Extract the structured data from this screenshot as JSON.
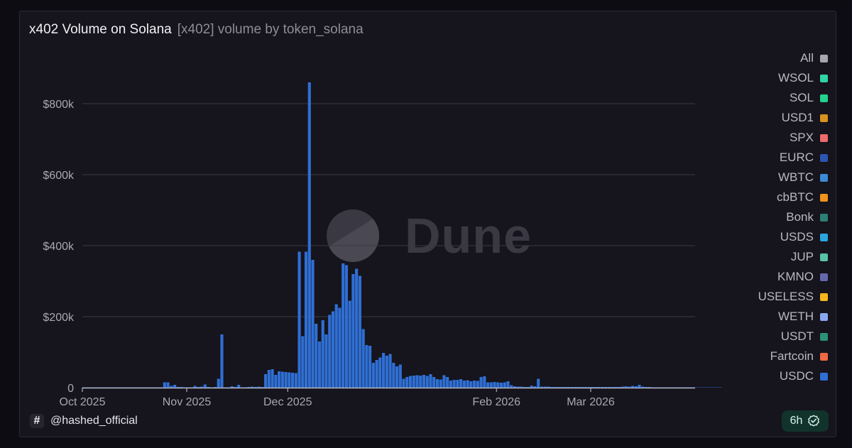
{
  "header": {
    "title": "x402 Volume on Solana",
    "subtitle": "[x402] volume by token_solana"
  },
  "legend": {
    "items": [
      {
        "label": "All",
        "color": "#a7a5ae"
      },
      {
        "label": "WSOL",
        "color": "#2fd6a2"
      },
      {
        "label": "SOL",
        "color": "#22d28f"
      },
      {
        "label": "USD1",
        "color": "#d9921f"
      },
      {
        "label": "SPX",
        "color": "#ef6a6a"
      },
      {
        "label": "EURC",
        "color": "#2d55b0"
      },
      {
        "label": "WBTC",
        "color": "#3d8ad6"
      },
      {
        "label": "cbBTC",
        "color": "#f2931d"
      },
      {
        "label": "Bonk",
        "color": "#2d7f74"
      },
      {
        "label": "USDS",
        "color": "#2aa4e0"
      },
      {
        "label": "JUP",
        "color": "#58c3a7"
      },
      {
        "label": "KMNO",
        "color": "#6568ad"
      },
      {
        "label": "USELESS",
        "color": "#f5b61d"
      },
      {
        "label": "WETH",
        "color": "#8aa8f0"
      },
      {
        "label": "USDT",
        "color": "#2c9279"
      },
      {
        "label": "Fartcoin",
        "color": "#f06a44"
      },
      {
        "label": "USDC",
        "color": "#2f6fd4"
      }
    ]
  },
  "watermark": {
    "text": "Dune",
    "icon": "dune-logo-icon"
  },
  "footer": {
    "handle": "@hashed_official",
    "hash_symbol": "#",
    "refresh_label": "6h",
    "refresh_icon": "verified-check-icon"
  },
  "chart_data": {
    "type": "bar",
    "x_start": "2025-10-01",
    "x_step_days": 1,
    "x_axis": {
      "range": [
        "2025-10-01",
        "2026-03-31"
      ],
      "tick_labels": [
        "Oct 2025",
        "Nov 2025",
        "Dec 2025",
        "Feb 2026",
        "Mar 2026"
      ],
      "tick_dates": [
        "2025-10-01",
        "2025-11-01",
        "2025-12-01",
        "2026-02-01",
        "2026-03-01"
      ]
    },
    "y_axis": {
      "range": [
        0,
        860000
      ],
      "ticks": [
        0,
        200000,
        400000,
        600000,
        800000
      ],
      "tick_labels": [
        "0",
        "$200k",
        "$400k",
        "$600k",
        "$800k"
      ]
    },
    "grid": "horizontal",
    "legend_position": "right",
    "series": [
      {
        "name": "USDC",
        "color": "#2f6fd4",
        "values": [
          1000,
          1000,
          1000,
          1000,
          1000,
          1000,
          1000,
          1000,
          1000,
          1000,
          1000,
          1000,
          1000,
          1000,
          1000,
          1000,
          1000,
          1000,
          1000,
          1000,
          1000,
          1000,
          1000,
          1000,
          15000,
          15000,
          5000,
          8000,
          2000,
          2000,
          1000,
          1000,
          1000,
          5000,
          2000,
          3000,
          9000,
          2000,
          1000,
          2000,
          25000,
          150000,
          1000,
          1000,
          4000,
          2000,
          8000,
          1000,
          1000,
          2000,
          3000,
          2000,
          3000,
          2000,
          38000,
          50000,
          52000,
          36000,
          46000,
          45000,
          44000,
          43000,
          42000,
          41000,
          383000,
          145000,
          383000,
          860000,
          360000,
          180000,
          130000,
          190000,
          150000,
          205000,
          215000,
          235000,
          225000,
          350000,
          345000,
          245000,
          320000,
          335000,
          315000,
          165000,
          120000,
          118000,
          70000,
          78000,
          85000,
          98000,
          90000,
          95000,
          70000,
          60000,
          65000,
          25000,
          30000,
          33000,
          34000,
          35000,
          34000,
          36000,
          33000,
          38000,
          30000,
          24000,
          23000,
          35000,
          30000,
          20000,
          22000,
          22000,
          24000,
          20000,
          21000,
          18000,
          20000,
          19000,
          30000,
          32000,
          15000,
          15000,
          16000,
          15000,
          14000,
          15000,
          18000,
          7000,
          4000,
          3000,
          3000,
          2000,
          2000,
          6000,
          4000,
          25000,
          3000,
          3000,
          3000,
          2000,
          2000,
          2000,
          2000,
          2000,
          2000,
          2000,
          2000,
          2000,
          2000,
          2000,
          2000,
          2000,
          2000,
          2000,
          2000,
          2000,
          2000,
          2000,
          2000,
          2000,
          3000,
          4000,
          3000,
          5000,
          4000,
          8000,
          3000,
          2000,
          2000,
          1000,
          1000,
          1000,
          1000,
          1000,
          1000,
          1000,
          1000,
          1000,
          1000,
          1000,
          1000,
          1000,
          1000,
          1000,
          1000,
          1000,
          1000,
          1000,
          1000,
          1000
        ]
      }
    ]
  }
}
